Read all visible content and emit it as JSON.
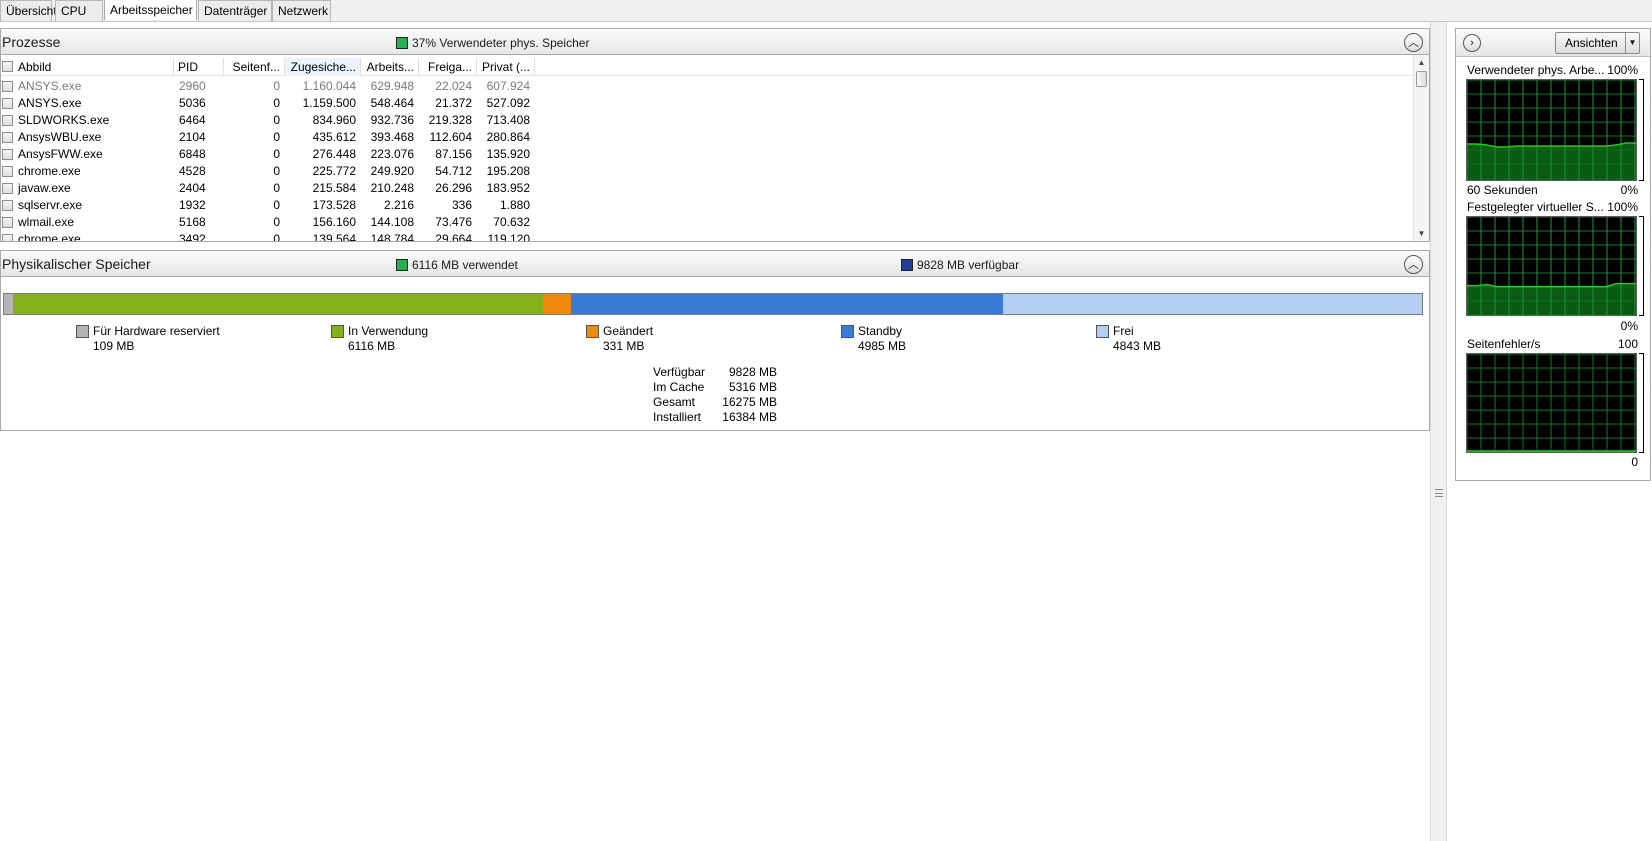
{
  "tabs": [
    {
      "label": "Übersicht",
      "active": false
    },
    {
      "label": "CPU",
      "active": false
    },
    {
      "label": "Arbeitsspeicher",
      "active": true
    },
    {
      "label": "Datenträger",
      "active": false
    },
    {
      "label": "Netzwerk",
      "active": false
    }
  ],
  "processes": {
    "title": "Prozesse",
    "metric_label": "37% Verwendeter phys. Speicher",
    "metric_color": "#22b14c",
    "columns": [
      "Abbild",
      "PID",
      "Seitenf...",
      "Zugesiche...",
      "Arbeits...",
      "Freiga...",
      "Privat (..."
    ],
    "sorted_column": "Zugesiche...",
    "rows": [
      {
        "image": "ANSYS.exe",
        "pid": "2960",
        "faults": "0",
        "commit": "1.160.044",
        "working": "629.948",
        "shareable": "22.024",
        "private": "607.924",
        "dim": true
      },
      {
        "image": "ANSYS.exe",
        "pid": "5036",
        "faults": "0",
        "commit": "1.159.500",
        "working": "548.464",
        "shareable": "21.372",
        "private": "527.092",
        "dim": false
      },
      {
        "image": "SLDWORKS.exe",
        "pid": "6464",
        "faults": "0",
        "commit": "834.960",
        "working": "932.736",
        "shareable": "219.328",
        "private": "713.408",
        "dim": false
      },
      {
        "image": "AnsysWBU.exe",
        "pid": "2104",
        "faults": "0",
        "commit": "435.612",
        "working": "393.468",
        "shareable": "112.604",
        "private": "280.864",
        "dim": false
      },
      {
        "image": "AnsysFWW.exe",
        "pid": "6848",
        "faults": "0",
        "commit": "276.448",
        "working": "223.076",
        "shareable": "87.156",
        "private": "135.920",
        "dim": false
      },
      {
        "image": "chrome.exe",
        "pid": "4528",
        "faults": "0",
        "commit": "225.772",
        "working": "249.920",
        "shareable": "54.712",
        "private": "195.208",
        "dim": false
      },
      {
        "image": "javaw.exe",
        "pid": "2404",
        "faults": "0",
        "commit": "215.584",
        "working": "210.248",
        "shareable": "26.296",
        "private": "183.952",
        "dim": false
      },
      {
        "image": "sqlservr.exe",
        "pid": "1932",
        "faults": "0",
        "commit": "173.528",
        "working": "2.216",
        "shareable": "336",
        "private": "1.880",
        "dim": false
      },
      {
        "image": "wlmail.exe",
        "pid": "5168",
        "faults": "0",
        "commit": "156.160",
        "working": "144.108",
        "shareable": "73.476",
        "private": "70.632",
        "dim": false
      },
      {
        "image": "chrome.exe",
        "pid": "3492",
        "faults": "0",
        "commit": "139.564",
        "working": "148.784",
        "shareable": "29.664",
        "private": "119.120",
        "dim": false
      }
    ]
  },
  "physical": {
    "title": "Physikalischer Speicher",
    "used_label": "6116 MB verwendet",
    "used_color": "#22b14c",
    "available_label": "9828 MB verfügbar",
    "available_color": "#1e3f9e",
    "legend": [
      {
        "label": "Für Hardware reserviert",
        "value": "109 MB",
        "mb": 109,
        "color": "#b4b4b4"
      },
      {
        "label": "In Verwendung",
        "value": "6116 MB",
        "mb": 6116,
        "color": "#84b01a"
      },
      {
        "label": "Geändert",
        "value": "331 MB",
        "mb": 331,
        "color": "#f08a0c"
      },
      {
        "label": "Standby",
        "value": "4985 MB",
        "mb": 4985,
        "color": "#3a7bd5"
      },
      {
        "label": "Frei",
        "value": "4843 MB",
        "mb": 4843,
        "color": "#b4cdf2"
      }
    ],
    "stats": [
      {
        "label": "Verfügbar",
        "value": "9828 MB"
      },
      {
        "label": "Im Cache",
        "value": "5316 MB"
      },
      {
        "label": "Gesamt",
        "value": "16275 MB"
      },
      {
        "label": "Installiert",
        "value": "16384 MB"
      }
    ]
  },
  "right_pane": {
    "view_button": "Ansichten",
    "graph_line_color": "#16d21c",
    "graph_fill_color": "#0a6b18",
    "grid_color": "#0b7a2a",
    "graphs": [
      {
        "title": "Verwendeter phys. Arbe...",
        "max": "100%",
        "footer_left": "60 Sekunden",
        "footer_right": "0%",
        "levels": [
          0.36,
          0.36,
          0.35,
          0.33,
          0.33,
          0.34,
          0.34,
          0.34,
          0.34,
          0.34,
          0.34,
          0.34,
          0.34,
          0.34,
          0.34,
          0.35,
          0.37,
          0.37
        ]
      },
      {
        "title": "Festgelegter virtueller S...",
        "max": "100%",
        "footer_left": "",
        "footer_right": "0%",
        "levels": [
          0.3,
          0.3,
          0.31,
          0.29,
          0.29,
          0.29,
          0.29,
          0.29,
          0.29,
          0.29,
          0.29,
          0.29,
          0.29,
          0.29,
          0.29,
          0.32,
          0.32,
          0.32
        ]
      },
      {
        "title": "Seitenfehler/s",
        "max": "100",
        "footer_left": "",
        "footer_right": "0",
        "levels": [
          0.0,
          0.0,
          0.0,
          0.0,
          0.0,
          0.01,
          0.0,
          0.0,
          0.0,
          0.01,
          0.0,
          0.0,
          0.0,
          0.0,
          0.0,
          0.0,
          0.0,
          0.0
        ]
      }
    ]
  }
}
